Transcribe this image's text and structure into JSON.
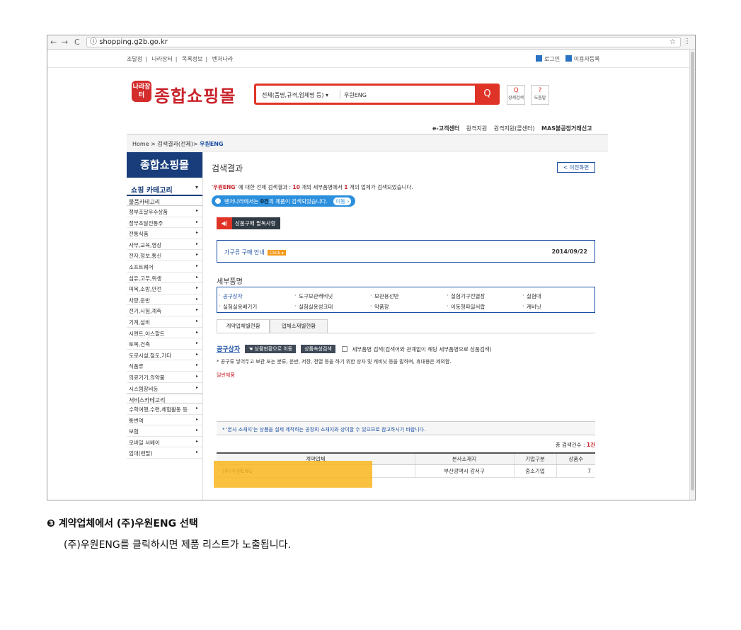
{
  "browser": {
    "url": "shopping.g2b.go.kr",
    "info_icon": "ⓘ",
    "star": "☆",
    "menu": "⋮",
    "back": "←",
    "forward": "→",
    "reload": "C"
  },
  "utility": {
    "links": [
      "조달청",
      "나라장터",
      "목록정보",
      "벤처나라"
    ],
    "separator": "|",
    "login": "로그인",
    "join": "이용자등록"
  },
  "logo": {
    "badge": "나라장터",
    "title": "종합쇼핑몰"
  },
  "search": {
    "category": "전체(품명,규격,업체명 등)",
    "caret": "▾",
    "value": "우원ENG",
    "button": "Q"
  },
  "mini_buttons": [
    {
      "icon": "Q",
      "label": "상세검색"
    },
    {
      "icon": "?",
      "label": "도움말"
    }
  ],
  "sublinks": [
    "e-고객센터",
    "원격지원",
    "원격지원(콜센터)",
    "MAS불공정거래신고"
  ],
  "breadcrumb": {
    "home": "Home >",
    "mid": "검색결과(전체)>",
    "current": "우원ENG"
  },
  "sidebar": {
    "header": "종합쇼핑몰",
    "category_label": "쇼핑 카테고리",
    "caret": "▾",
    "goods_section": "물품카테고리",
    "goods": [
      "정부조달우수상품",
      "정부조달전통주",
      "전통식품",
      "사무,교육,영상",
      "전자,정보,통신",
      "소프트웨어",
      "섬유,고무,위생",
      "피복,소방,안전",
      "차량,운반",
      "전기,시험,계측",
      "기계,설비",
      "시멘트,아스팔트",
      "토목,건축",
      "도로시설,철도,기타",
      "식품류",
      "의료기기,의약품",
      "시스템장비등"
    ],
    "service_section": "서비스카테고리",
    "services": [
      "수학여행,수련,체험활동 등",
      "통번역",
      "보험",
      "모바일 서베이",
      "임대(렌탈)"
    ],
    "arrow": "▸"
  },
  "main": {
    "title": "검색결과",
    "prev_button": "< 이전화면",
    "summary": {
      "q1": "'",
      "keyword": "우원ENG",
      "q2": "' 에 대한 전체 검색결과 : ",
      "total": "10",
      "mid": " 개의 세부품명에서 ",
      "vendors": "1",
      "tail": " 개의 업체가 검색되었습니다."
    },
    "notice": {
      "pre": "벤처나라에서는 ",
      "count": "0건",
      "post": "의 제품이 검색되었습니다.",
      "move": "이동 ›"
    },
    "red_chip": {
      "icon": "◀)",
      "label": "상품구매 필독사항"
    },
    "guide": {
      "label": "가구류 구매 안내",
      "click": "Click ▸",
      "date": "2014/09/22"
    },
    "detail_title": "세부품명",
    "details": [
      "공구상자",
      "도구보관캐비닛",
      "보관용선반",
      "실험기구전열장",
      "실험대",
      "실험실용배기기",
      "실험실용성크대",
      "약품장",
      "이동형파일서랍",
      "캐비닛"
    ],
    "tabs": [
      "계약업체별현황",
      "업체소재별현황"
    ],
    "product_name": "공구상자",
    "btn_status": "☚ 상품현황으로 이동",
    "btn_attr": "상품속성검색",
    "detail_search": "세부품명 검색(검색어와 관계없이 해당 세부품명으로 상품검색)",
    "desc": "* 공구류 넣어두고 보관 또는 분류, 운반, 저장, 전열 등을 하기 위한 상자 및 캐비닛 등을 말하며, 휴대용은 제외함.",
    "general": "일반제품",
    "warn": "* '본사 소재지'는 상품을 실제 제작하는 공장의 소재지와 상이할 수 있으므로 참고하시기 바랍니다.",
    "count_label": "총 검색건수 : ",
    "count_value": "1건",
    "table": {
      "headers": [
        "계약업체",
        "본사소재지",
        "기업구분",
        "상품수"
      ],
      "rows": [
        [
          "(주)우원ENG",
          "부산광역시 강서구",
          "중소기업",
          "7"
        ]
      ]
    }
  },
  "caption": {
    "title": "❸ 계약업체에서 (주)우원ENG 선택",
    "body": "(주)우원ENG를 클릭하시면 제품 리스트가 노출됩니다."
  },
  "colors": {
    "brand_red": "#e03327",
    "navy": "#183d7a",
    "blue": "#1b4fa3",
    "highlight": "#f9b51f"
  }
}
